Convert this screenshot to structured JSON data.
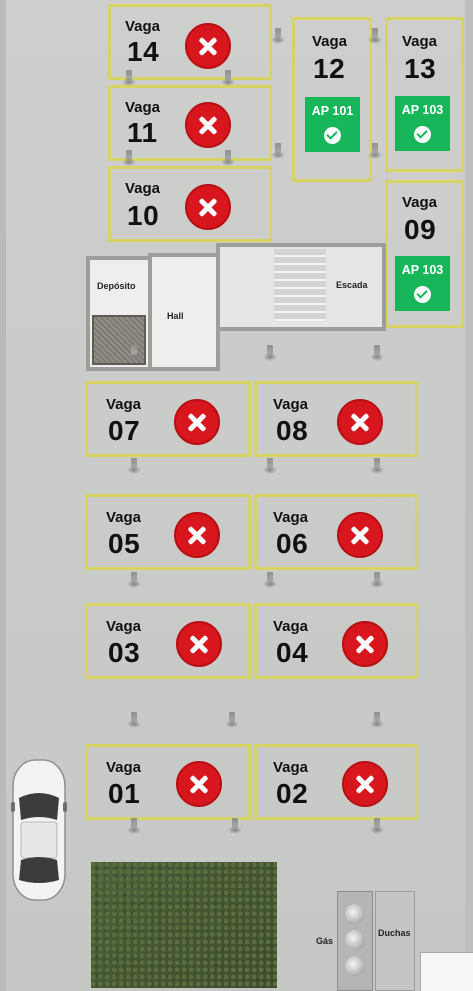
{
  "spots": [
    {
      "label": "Vaga",
      "number": "14",
      "status": "blocked"
    },
    {
      "label": "Vaga",
      "number": "11",
      "status": "blocked"
    },
    {
      "label": "Vaga",
      "number": "10",
      "status": "blocked"
    },
    {
      "label": "Vaga",
      "number": "12",
      "status": "assigned",
      "assigned_to": "AP 101"
    },
    {
      "label": "Vaga",
      "number": "13",
      "status": "assigned",
      "assigned_to": "AP 103"
    },
    {
      "label": "Vaga",
      "number": "09",
      "status": "assigned",
      "assigned_to": "AP 103"
    },
    {
      "label": "Vaga",
      "number": "07",
      "status": "blocked"
    },
    {
      "label": "Vaga",
      "number": "08",
      "status": "blocked"
    },
    {
      "label": "Vaga",
      "number": "05",
      "status": "blocked"
    },
    {
      "label": "Vaga",
      "number": "06",
      "status": "blocked"
    },
    {
      "label": "Vaga",
      "number": "03",
      "status": "blocked"
    },
    {
      "label": "Vaga",
      "number": "04",
      "status": "blocked"
    },
    {
      "label": "Vaga",
      "number": "01",
      "status": "blocked"
    },
    {
      "label": "Vaga",
      "number": "02",
      "status": "blocked"
    }
  ],
  "rooms": {
    "deposito": "Depósito",
    "hall": "Hall",
    "escada": "Escada",
    "gas": "Gás",
    "duchas": "Duchas"
  },
  "icons": {
    "blocked": "red-x-icon",
    "assigned": "check-circle-icon"
  },
  "colors": {
    "spot_outline": "#d8d463",
    "blocked": "#d8161d",
    "assigned": "#17b65b"
  }
}
